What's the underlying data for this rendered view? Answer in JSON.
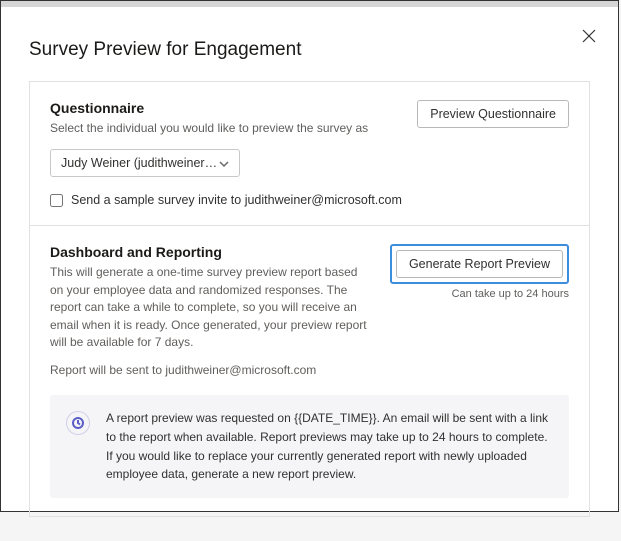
{
  "dialog": {
    "title": "Survey Preview for Engagement"
  },
  "questionnaire": {
    "title": "Questionnaire",
    "subtext": "Select the individual you would like to preview the survey as",
    "preview_button": "Preview Questionnaire",
    "dropdown_value": "Judy Weiner (judithweiner…",
    "checkbox_label": "Send a sample survey invite to judithweiner@microsoft.com"
  },
  "dashboard": {
    "title": "Dashboard and Reporting",
    "subtext": "This will generate a one-time survey preview report based on your employee data and randomized responses. The report can take a while to complete, so you will receive an email when it is ready. Once generated, your preview report will be available for 7 days.",
    "generate_button": "Generate Report Preview",
    "hint": "Can take up to 24 hours",
    "sent_to": "Report will be sent to judithweiner@microsoft.com",
    "info_text": "A report preview was requested on {{DATE_TIME}}. An email will be sent with a link to the report when available. Report previews may take up to 24 hours to complete. If you would like to replace your currently generated report with newly uploaded employee data, generate a new report preview."
  }
}
